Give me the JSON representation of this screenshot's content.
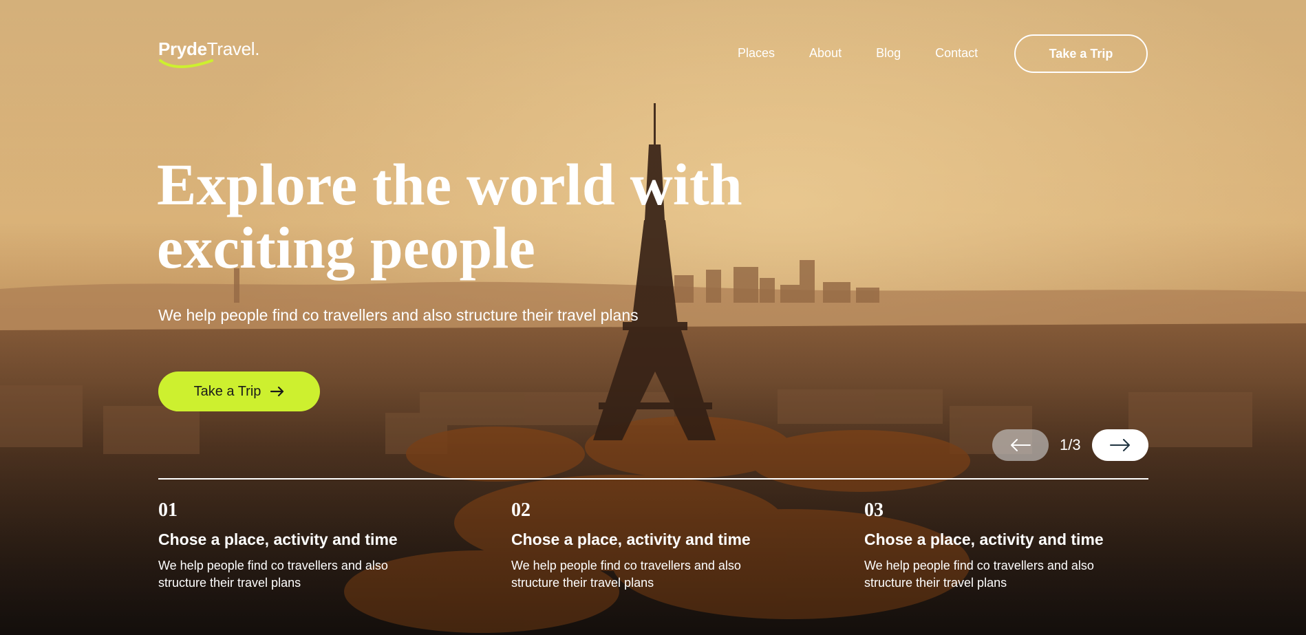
{
  "header": {
    "logo_primary": "Pryde",
    "logo_secondary": "Travel.",
    "nav": [
      "Places",
      "About",
      "Blog",
      "Contact"
    ],
    "cta_label": "Take a Trip"
  },
  "hero": {
    "headline_line1": "Explore the world with",
    "headline_line2": "exciting people",
    "subheadline": "We help people find co travellers and also structure their travel plans",
    "cta_label": "Take a Trip",
    "cta_icon": "arrow-right-icon"
  },
  "slider": {
    "counter": "1/3",
    "prev_icon": "arrow-left-icon",
    "next_icon": "arrow-right-icon"
  },
  "steps": [
    {
      "number": "01",
      "title": "Chose a place, activity and time",
      "description": "We help people find co travellers and also structure their travel plans"
    },
    {
      "number": "02",
      "title": "Chose a place, activity and time",
      "description": "We help people find co travellers and also structure their travel plans"
    },
    {
      "number": "03",
      "title": "Chose a place, activity and time",
      "description": "We help people find co travellers and also structure their travel plans"
    }
  ],
  "colors": {
    "accent": "#cdf02f",
    "text": "#ffffff",
    "cta_text": "#1a1a1a"
  },
  "background": {
    "scene": "eiffel-tower-sunset-photo"
  }
}
